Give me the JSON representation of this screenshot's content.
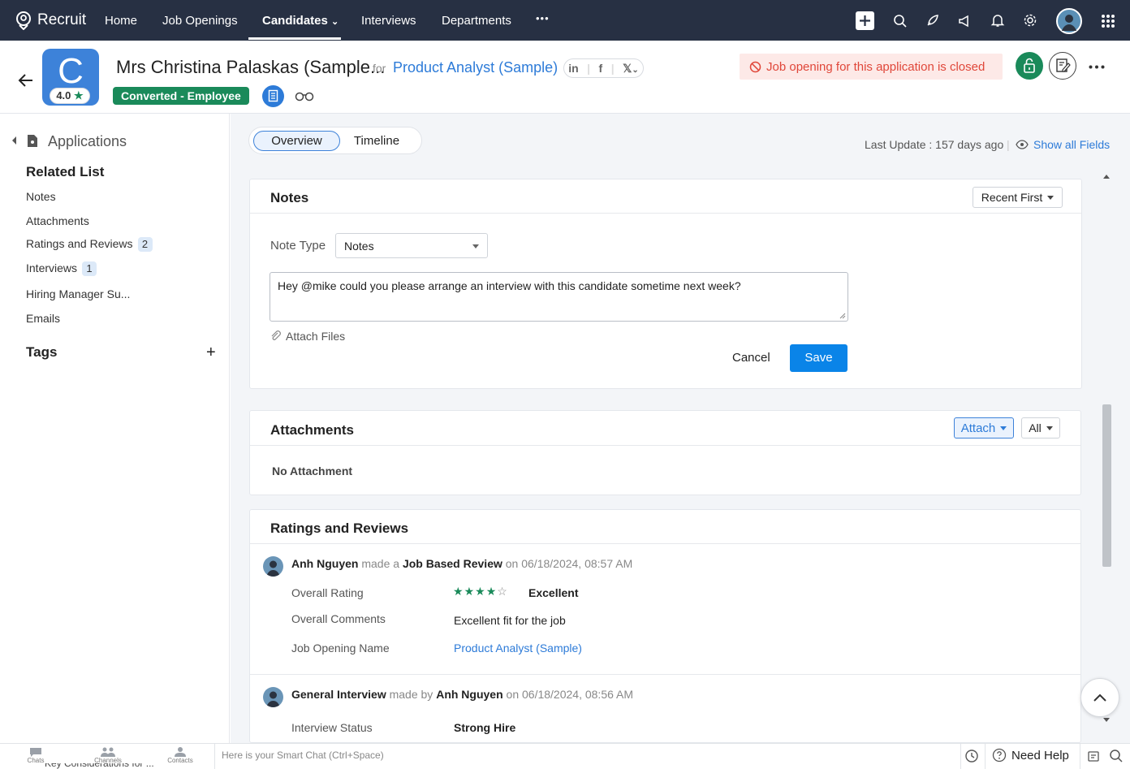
{
  "nav": {
    "app_name": "Recruit",
    "items": [
      "Home",
      "Job Openings",
      "Candidates",
      "Interviews",
      "Departments"
    ],
    "more": "•••"
  },
  "header": {
    "avatar_letter": "C",
    "rating": "4.0",
    "candidate_name": "Mrs Christina Palaskas (Sample...",
    "for_text": "for",
    "job_title": "Product Analyst (Sample)",
    "status": "Converted - Employee",
    "social": {
      "linkedin": "in",
      "facebook": "f",
      "x": "𝕏"
    },
    "closed_notice": "Job opening for this application is closed"
  },
  "sidebar": {
    "applications": "Applications",
    "related_list_title": "Related List",
    "items": [
      {
        "label": "Notes",
        "count": null
      },
      {
        "label": "Attachments",
        "count": null
      },
      {
        "label": "Ratings and Reviews",
        "count": "2"
      },
      {
        "label": "Interviews",
        "count": "1"
      },
      {
        "label": "Hiring Manager Su...",
        "count": null
      },
      {
        "label": "Emails",
        "count": null
      }
    ],
    "tags_title": "Tags",
    "add_symbol": "+"
  },
  "main": {
    "tabs": [
      "Overview",
      "Timeline"
    ],
    "last_update": "Last Update : 157 days ago",
    "show_all_fields": "Show all Fields"
  },
  "notes": {
    "title": "Notes",
    "sort_label": "Recent First",
    "note_type_label": "Note Type",
    "note_type_value": "Notes",
    "text": "Hey @mike could you please arrange an interview with this candidate sometime next week?",
    "attach_files": "Attach Files",
    "cancel": "Cancel",
    "save": "Save"
  },
  "attachments": {
    "title": "Attachments",
    "attach_btn": "Attach",
    "filter": "All",
    "empty": "No Attachment"
  },
  "ratings": {
    "title": "Ratings and Reviews",
    "review1": {
      "reviewer": "Anh Nguyen",
      "made_a": "made a",
      "review_type": "Job Based Review",
      "on_date": "on 06/18/2024, 08:57 AM",
      "stars": 4,
      "rows": [
        {
          "label": "Overall Rating",
          "value": "Excellent"
        },
        {
          "label": "Overall Comments",
          "value": "Excellent fit for the job"
        },
        {
          "label": "Job Opening Name",
          "value": "Product Analyst (Sample)"
        }
      ]
    },
    "review2": {
      "review_type": "General Interview",
      "made_by": "made by",
      "reviewer": "Anh Nguyen",
      "on_date": "on 06/18/2024, 08:56 AM",
      "label": "Interview Status",
      "value": "Strong Hire"
    }
  },
  "bottombar": {
    "chats": "Chats",
    "channels": "Channels",
    "contacts": "Contacts",
    "smart_chat_placeholder": "Here is your Smart Chat (Ctrl+Space)",
    "need_help": "Need Help",
    "behind_text": "Key Considerations for ..."
  },
  "colors": {
    "nav_bg": "#273043",
    "accent": "#2d7bd8",
    "save_btn": "#0a84e8",
    "status_green": "#1a8a5a",
    "closed_red": "#e0473a"
  }
}
